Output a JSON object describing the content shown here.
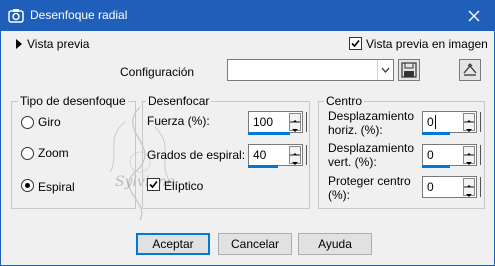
{
  "window": {
    "title": "Desenfoque radial",
    "camera_icon": "camera-icon",
    "close_icon": "close-icon"
  },
  "preview": {
    "label": "Vista previa",
    "in_image_label": "Vista previa en imagen",
    "in_image_checked": true
  },
  "config": {
    "label": "Configuración",
    "value": "",
    "save_icon": "floppy-disk-icon",
    "reset_icon": "reset-icon"
  },
  "blur_type": {
    "title": "Tipo de desenfoque",
    "options": [
      {
        "label": "Giro",
        "selected": false
      },
      {
        "label": "Zoom",
        "selected": false
      },
      {
        "label": "Espiral",
        "selected": true
      }
    ]
  },
  "blur": {
    "title": "Desenfocar",
    "strength_label": "Fuerza (%):",
    "strength_value": "100",
    "spiral_label": "Grados de espiral:",
    "spiral_value": "40",
    "elliptical_label": "Elíptico",
    "elliptical_checked": true
  },
  "center": {
    "title": "Centro",
    "horiz_label_1": "Desplazamiento",
    "horiz_label_2": "horiz. (%):",
    "horiz_value": "0",
    "vert_label_1": "Desplazamiento",
    "vert_label_2": "vert. (%):",
    "vert_value": "0",
    "protect_label_1": "Proteger centro",
    "protect_label_2": "(%):",
    "protect_value": "0"
  },
  "buttons": {
    "ok": "Aceptar",
    "cancel": "Cancelar",
    "help": "Ayuda"
  },
  "watermark": {
    "text": "Sylviane"
  },
  "colors": {
    "titlebar": "#205fb9",
    "accent": "#0078d7",
    "window_bg": "#f0f0f0"
  }
}
